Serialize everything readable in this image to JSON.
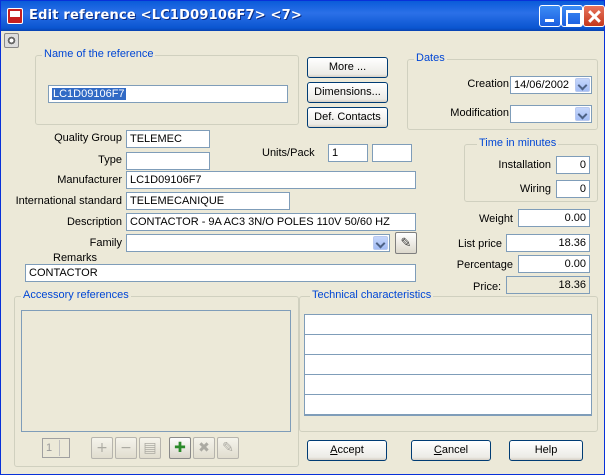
{
  "window": {
    "title": "Edit reference <LC1D09106F7> <7>"
  },
  "reference": {
    "group_label": "Name of the reference",
    "name_value": "LC1D09106F7"
  },
  "buttons": {
    "more": "More ...",
    "dimensions": "Dimensions...",
    "def_contacts": "Def. Contacts",
    "accept_prefix": "A",
    "accept_rest": "ccept",
    "cancel_prefix": "C",
    "cancel_rest": "ancel",
    "help": "Help"
  },
  "dates": {
    "group_label": "Dates",
    "creation_label": "Creation",
    "creation_value": "14/06/2002",
    "modification_label": "Modification",
    "modification_value": ""
  },
  "fields": {
    "quality_group_label": "Quality Group",
    "quality_group_value": "TELEMEC",
    "type_label": "Type",
    "type_value": "",
    "units_pack_label": "Units/Pack",
    "units_pack_value": "1",
    "units_pack_value2": "",
    "manufacturer_label": "Manufacturer",
    "manufacturer_value": "LC1D09106F7",
    "intl_standard_label": "International standard",
    "intl_standard_value": "TELEMECANIQUE",
    "description_label": "Description",
    "description_value": "CONTACTOR - 9A AC3 3N/O POLES 110V  50/60 HZ",
    "family_label": "Family",
    "family_value": "",
    "remarks_label": "Remarks",
    "remarks_value": "CONTACTOR"
  },
  "time": {
    "group_label": "Time in minutes",
    "installation_label": "Installation",
    "installation_value": "0",
    "wiring_label": "Wiring",
    "wiring_value": "0"
  },
  "pricing": {
    "weight_label": "Weight",
    "weight_value": "0.00",
    "list_price_label": "List price",
    "list_price_value": "18.36",
    "percentage_label": "Percentage",
    "percentage_value": "0.00",
    "price_label": "Price:",
    "price_value": "18.36"
  },
  "accessory": {
    "group_label": "Accessory references",
    "spin_value": "1"
  },
  "technical": {
    "group_label": "Technical characteristics"
  },
  "colors": {
    "group_label": "#0046d5",
    "titlebar": "#0a5bd9",
    "selection": "#316ac5"
  }
}
